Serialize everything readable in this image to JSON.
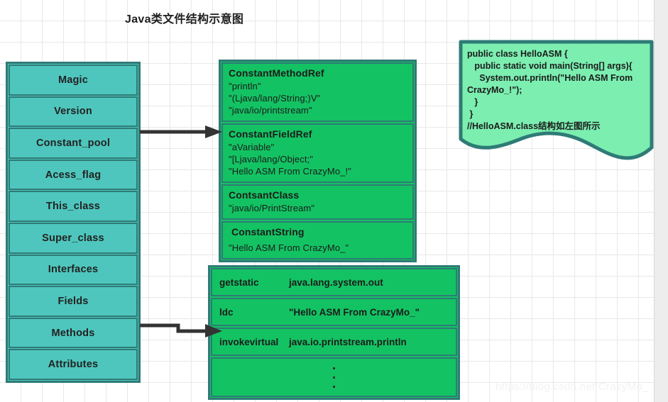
{
  "page": {
    "title": "Java类文件结构示意图",
    "watermark": "https://blog.csdn.net/CrazyMo_"
  },
  "colors": {
    "teal_fill": "#4ec6bd",
    "green_fill": "#13c363",
    "note_fill": "#7beeb0",
    "border": "#2f7b76",
    "arrow": "#333333",
    "background": "#ffffff",
    "grid_line": "#e8e8e8"
  },
  "class_structure": {
    "name": "class-file-structure",
    "rows": [
      {
        "label": "Magic"
      },
      {
        "label": "Version"
      },
      {
        "label": "Constant_pool"
      },
      {
        "label": "Acess_flag"
      },
      {
        "label": "This_class"
      },
      {
        "label": "Super_class"
      },
      {
        "label": "Interfaces"
      },
      {
        "label": "Fields"
      },
      {
        "label": "Methods"
      },
      {
        "label": "Attributes"
      }
    ]
  },
  "constant_pool": {
    "boxes": [
      {
        "title": "ConstantMethodRef",
        "lines": [
          "\"println\"",
          "\"(Ljava/lang/String;)V\"",
          "\"java/io/printstream\""
        ]
      },
      {
        "title": "ConstantFieldRef",
        "lines": [
          "\"aVariable\"",
          "\"[Ljava/lang/Object;\"",
          "\"Hello ASM From CrazyMo_!\""
        ]
      },
      {
        "title": "ContsantClass",
        "lines": [
          "\"java/io/PrintStream\""
        ]
      },
      {
        "title": "ConstantString",
        "lines": [
          "\"Hello ASM From CrazyMo_\""
        ]
      }
    ]
  },
  "bytecode": {
    "rows": [
      {
        "op": "getstatic",
        "arg": "java.lang.system.out"
      },
      {
        "op": "ldc",
        "arg": "\"Hello ASM From CrazyMo_\""
      },
      {
        "op": "invokevirtual",
        "arg": "java.io.printstream.println"
      }
    ],
    "ellipsis": "⋮"
  },
  "code_note": {
    "code": "public class HelloASM {\n   public static void main(String[] args){\n     System.out.println(\"Hello ASM From\nCrazyMo_!\");\n   }\n }\n//HelloASM.class结构如左图所示"
  },
  "arrows": [
    {
      "name": "arrow-constant-pool",
      "from": "Constant_pool",
      "to": "constant-pool-group"
    },
    {
      "name": "arrow-methods",
      "from": "Methods",
      "to": "bytecode-table"
    }
  ]
}
